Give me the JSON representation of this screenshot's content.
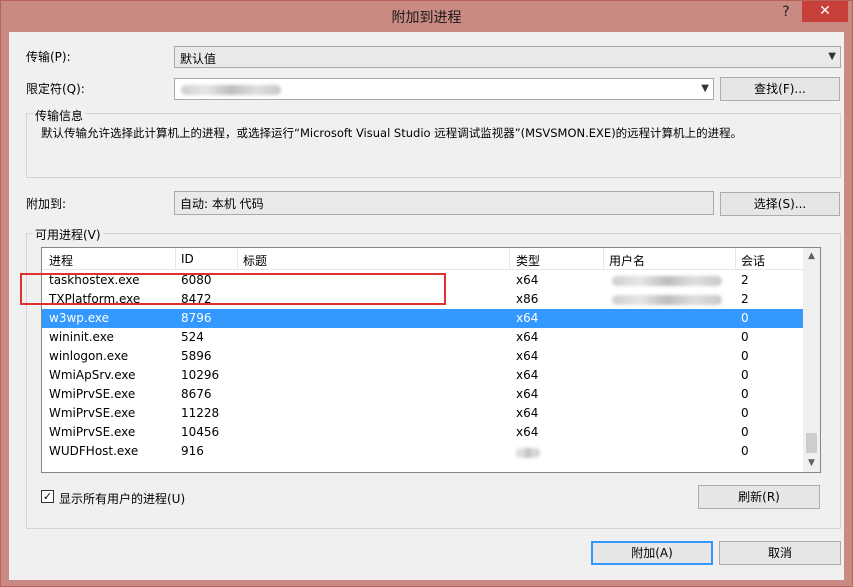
{
  "window": {
    "title": "附加到进程",
    "help_icon": "?",
    "close_icon": "✕"
  },
  "transport": {
    "label": "传输(P):",
    "value": "默认值"
  },
  "qualifier": {
    "label": "限定符(Q):",
    "value": ""
  },
  "find_button": "查找(F)...",
  "transport_info": {
    "title": "传输信息",
    "text": "默认传输允许选择此计算机上的进程，或选择运行“Microsoft Visual Studio 远程调试监视器”(MSVSMON.EXE)的远程计算机上的进程。"
  },
  "attach_to": {
    "label": "附加到:",
    "value": "自动: 本机 代码",
    "select_button": "选择(S)..."
  },
  "processes": {
    "title": "可用进程(V)",
    "columns": [
      "进程",
      "ID",
      "标题",
      "类型",
      "用户名",
      "会话"
    ],
    "rows": [
      {
        "name": "taskhostex.exe",
        "id": "6080",
        "title": "",
        "type": "x64",
        "user": "",
        "session": "2"
      },
      {
        "name": "TXPlatform.exe",
        "id": "8472",
        "title": "",
        "type": "x86",
        "user": "",
        "session": "2"
      },
      {
        "name": "w3wp.exe",
        "id": "8796",
        "title": "",
        "type": "x64",
        "user": "",
        "session": "0"
      },
      {
        "name": "wininit.exe",
        "id": "524",
        "title": "",
        "type": "x64",
        "user": "",
        "session": "0"
      },
      {
        "name": "winlogon.exe",
        "id": "5896",
        "title": "",
        "type": "x64",
        "user": "",
        "session": "0"
      },
      {
        "name": "WmiApSrv.exe",
        "id": "10296",
        "title": "",
        "type": "x64",
        "user": "",
        "session": "0"
      },
      {
        "name": "WmiPrvSE.exe",
        "id": "8676",
        "title": "",
        "type": "x64",
        "user": "",
        "session": "0"
      },
      {
        "name": "WmiPrvSE.exe",
        "id": "11228",
        "title": "",
        "type": "x64",
        "user": "",
        "session": "0"
      },
      {
        "name": "WmiPrvSE.exe",
        "id": "10456",
        "title": "",
        "type": "x64",
        "user": "",
        "session": "0"
      },
      {
        "name": "WUDFHost.exe",
        "id": "916",
        "title": "",
        "type": "",
        "user": "",
        "session": "0"
      }
    ],
    "selected_index": 2
  },
  "show_all_users": {
    "label": "显示所有用户的进程(U)",
    "checked": true
  },
  "refresh_button": "刷新(R)",
  "attach_button": "附加(A)",
  "cancel_button": "取消",
  "colors": {
    "titlebar": "#c98a83",
    "close": "#c7403a",
    "selection": "#3399ff",
    "highlight": "#e0312f"
  }
}
